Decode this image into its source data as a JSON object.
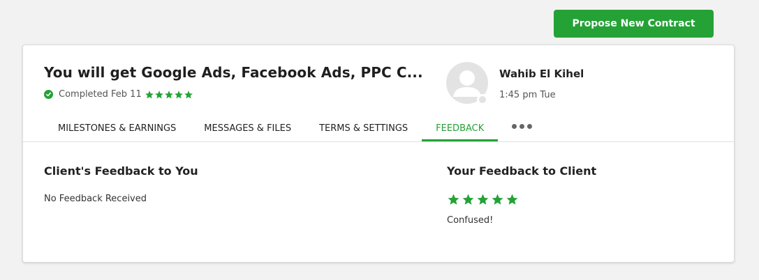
{
  "header": {
    "propose_button_label": "Propose New Contract"
  },
  "contract": {
    "title": "You will get Google Ads, Facebook Ads, PPC C...",
    "status_text": "Completed Feb 11",
    "rating": 5
  },
  "client": {
    "name": "Wahib El Kihel",
    "local_time": "1:45 pm Tue"
  },
  "tabs": [
    {
      "label": "MILESTONES & EARNINGS",
      "active": false
    },
    {
      "label": "MESSAGES & FILES",
      "active": false
    },
    {
      "label": "TERMS & SETTINGS",
      "active": false
    },
    {
      "label": "FEEDBACK",
      "active": true
    }
  ],
  "client_feedback": {
    "title": "Client's Feedback to You",
    "text": "No Feedback Received"
  },
  "your_feedback": {
    "title": "Your Feedback to Client",
    "rating": 5,
    "comment": "Confused!"
  },
  "colors": {
    "accent": "#24a236",
    "background": "#f2f2f3"
  },
  "icons": {
    "status": "check-circle-icon",
    "rating": "star-icon",
    "more": "more-dots-icon",
    "avatar": "user-avatar-placeholder"
  }
}
